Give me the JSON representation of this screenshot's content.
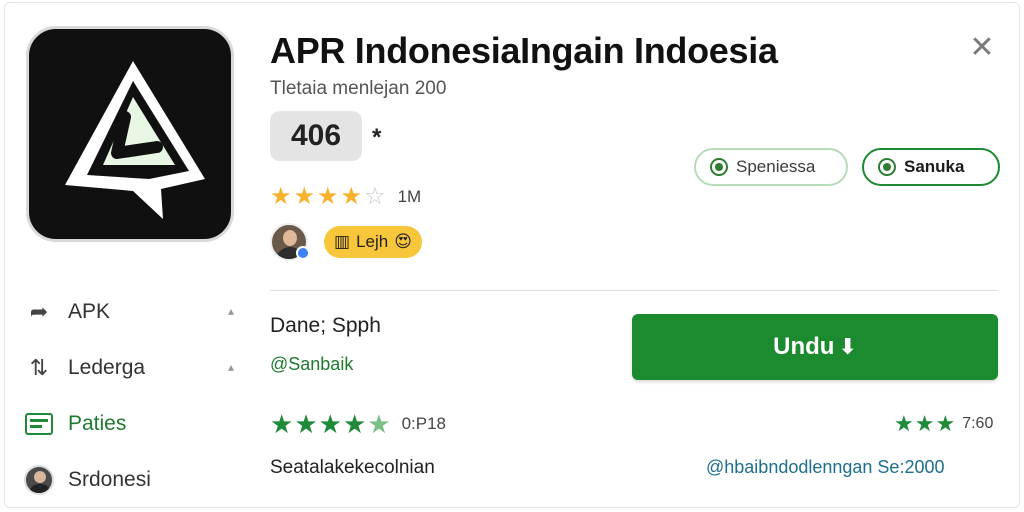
{
  "app": {
    "title": "APR IndonesiaIngain Indoesia",
    "subtitle": "Tletaia menlejan 200",
    "price": "406",
    "marker": "*",
    "rating_stars": 3.5,
    "rating_count": "1M",
    "tag_label": "Lejh"
  },
  "chips": {
    "outline_label": "Speniessa",
    "solid_label": "Sanuka"
  },
  "menu": {
    "items": [
      {
        "label": "APK",
        "icon": "share-icon"
      },
      {
        "label": "Lederga",
        "icon": "sort-icon"
      },
      {
        "label": "Paties",
        "icon": "flag-icon"
      },
      {
        "label": "Srdonesi",
        "icon": "avatar-icon"
      }
    ]
  },
  "developer": {
    "name": "Dane; Spph",
    "handle": "@Sanbaik"
  },
  "install": {
    "label": "Undu"
  },
  "reviews": {
    "left_stars": 4.5,
    "left_score": "0:P18",
    "right_stars": 3,
    "right_score": "7:60"
  },
  "footer": {
    "summary": "Seatalakekecolnian",
    "link": "@hbaibndodlenngan Se:2000"
  },
  "colors": {
    "accent_green": "#1c8a2e",
    "star_gold": "#f6b32b",
    "link_blue": "#1d6f8e"
  }
}
